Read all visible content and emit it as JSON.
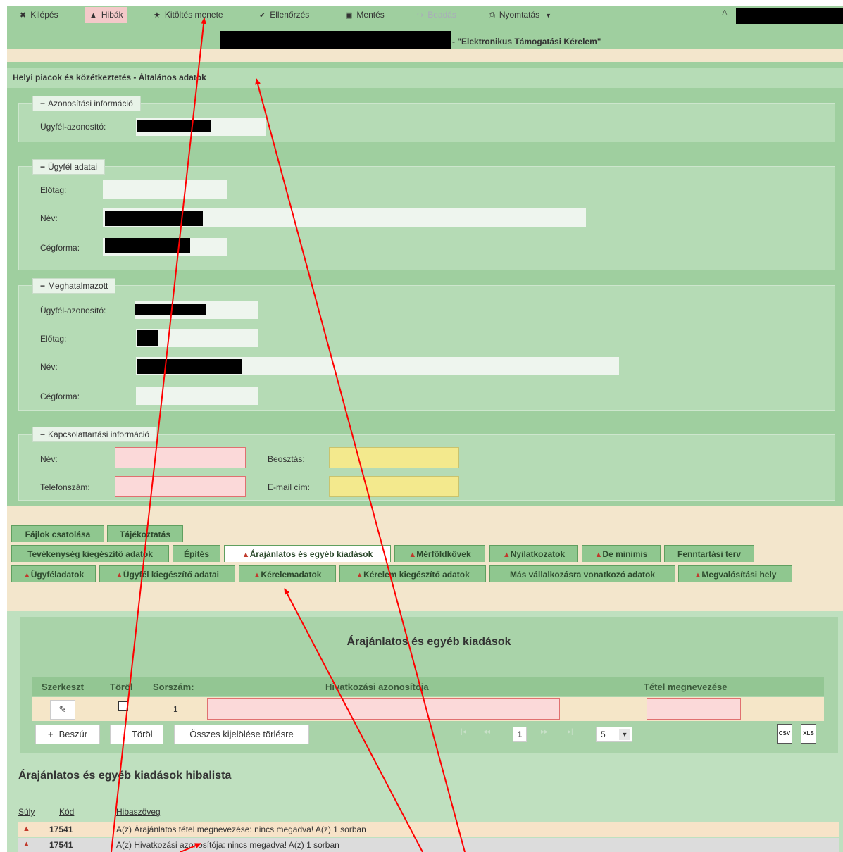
{
  "toolbar": {
    "exit_label": "Kilépés",
    "errors_label": "Hibák",
    "progress_label": "Kitöltés menete",
    "check_label": "Ellenőrzés",
    "save_label": "Mentés",
    "submit_label": "Beadás",
    "print_label": "Nyomtatás",
    "form_title": "- \"Elektronikus Támogatási Kérelem\""
  },
  "form": {
    "header": "Helyi piacok és közétkeztetés - Általános adatok",
    "identification": {
      "legend": "Azonosítási információ",
      "client_id_label": "Ügyfél-azonosító:"
    },
    "client": {
      "legend": "Ügyfél adatai",
      "prefix_label": "Előtag:",
      "name_label": "Név:",
      "company_form_label": "Cégforma:"
    },
    "agent": {
      "legend": "Meghatalmazott",
      "client_id_label": "Ügyfél-azonosító:",
      "prefix_label": "Előtag:",
      "name_label": "Név:",
      "company_form_label": "Cégforma:"
    },
    "contact": {
      "legend": "Kapcsolattartási információ",
      "name_label": "Név:",
      "position_label": "Beosztás:",
      "phone_label": "Telefonszám:",
      "email_label": "E-mail cím:"
    }
  },
  "tabs": {
    "row1": [
      "Fájlok csatolása",
      "Tájékoztatás"
    ],
    "row2": [
      "Tevékenység kiegészítő adatok",
      "Építés",
      "Árajánlatos és egyéb kiadások",
      "Mérföldkövek",
      "Nyilatkozatok",
      "De minimis",
      "Fenntartási terv"
    ],
    "row3": [
      "Ügyféladatok",
      "Ügyfél kiegészítő adatai",
      "Kérelemadatok",
      "Kérelem kiegészítő adatok",
      "Más vállalkozásra vonatkozó adatok",
      "Megvalósítási hely"
    ]
  },
  "panel": {
    "title": "Árajánlatos és egyéb kiadások",
    "columns": [
      "Szerkeszt",
      "Töröl",
      "Sorszám:",
      "Hivatkozási azonosítója",
      "Tétel megnevezése"
    ],
    "row_number": "1",
    "insert_button": "Beszúr",
    "delete_button": "Töröl",
    "select_all_button": "Összes kijelölése törlésre",
    "current_page": "1",
    "page_size": "5",
    "csv_label": "CSV",
    "xls_label": "XLS"
  },
  "errors": {
    "title": "Árajánlatos és egyéb kiadások hibalista",
    "columns": [
      "Súly",
      "Kód",
      "Hibaszöveg"
    ],
    "rows": [
      {
        "code": "17541",
        "text": "A(z) Árajánlatos tétel megnevezése: nincs megadva! A(z) 1 sorban"
      },
      {
        "code": "17541",
        "text": "A(z) Hivatkozási azonosítója: nincs megadva! A(z) 1 sorban"
      }
    ]
  },
  "colors": {
    "toolbar_bg": "#9fcf9f",
    "error_field": "#fbd9d9",
    "warning_field": "#f3e98d",
    "annotation_arrow": "#ff0000"
  }
}
